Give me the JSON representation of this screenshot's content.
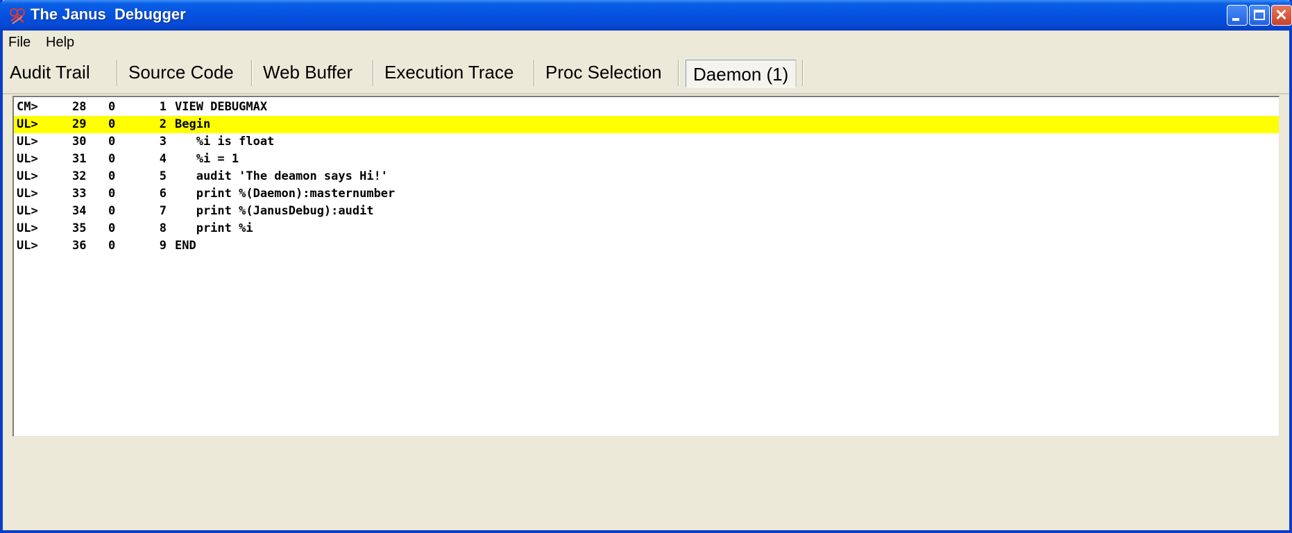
{
  "window": {
    "title": "The Janus  Debugger",
    "app_icon": "janus-app-icon",
    "controls": {
      "minimize": "minimize-icon",
      "maximize": "maximize-icon",
      "close": "close-icon",
      "close_glyph": "✕"
    }
  },
  "menu": {
    "items": [
      {
        "label": "File"
      },
      {
        "label": "Help"
      }
    ]
  },
  "tabs": [
    {
      "label": "Audit Trail",
      "active": false
    },
    {
      "label": "Source Code",
      "active": false
    },
    {
      "label": "Web Buffer",
      "active": false
    },
    {
      "label": "Execution Trace",
      "active": false
    },
    {
      "label": "Proc Selection",
      "active": false
    },
    {
      "label": "Daemon (1)",
      "active": true
    }
  ],
  "listing": {
    "highlight_color": "#ffff00",
    "highlight_row": 1,
    "rows": [
      {
        "type": "CM>",
        "num": "28",
        "zero": "0",
        "line": "1",
        "code": "VIEW DEBUGMAX"
      },
      {
        "type": "UL>",
        "num": "29",
        "zero": "0",
        "line": "2",
        "code": "Begin"
      },
      {
        "type": "UL>",
        "num": "30",
        "zero": "0",
        "line": "3",
        "code": "   %i is float"
      },
      {
        "type": "UL>",
        "num": "31",
        "zero": "0",
        "line": "4",
        "code": "   %i = 1"
      },
      {
        "type": "UL>",
        "num": "32",
        "zero": "0",
        "line": "5",
        "code": "   audit 'The deamon says Hi!'"
      },
      {
        "type": "UL>",
        "num": "33",
        "zero": "0",
        "line": "6",
        "code": "   print %(Daemon):masternumber"
      },
      {
        "type": "UL>",
        "num": "34",
        "zero": "0",
        "line": "7",
        "code": "   print %(JanusDebug):audit"
      },
      {
        "type": "UL>",
        "num": "35",
        "zero": "0",
        "line": "8",
        "code": "   print %i"
      },
      {
        "type": "UL>",
        "num": "36",
        "zero": "0",
        "line": "9",
        "code": "END"
      }
    ]
  }
}
